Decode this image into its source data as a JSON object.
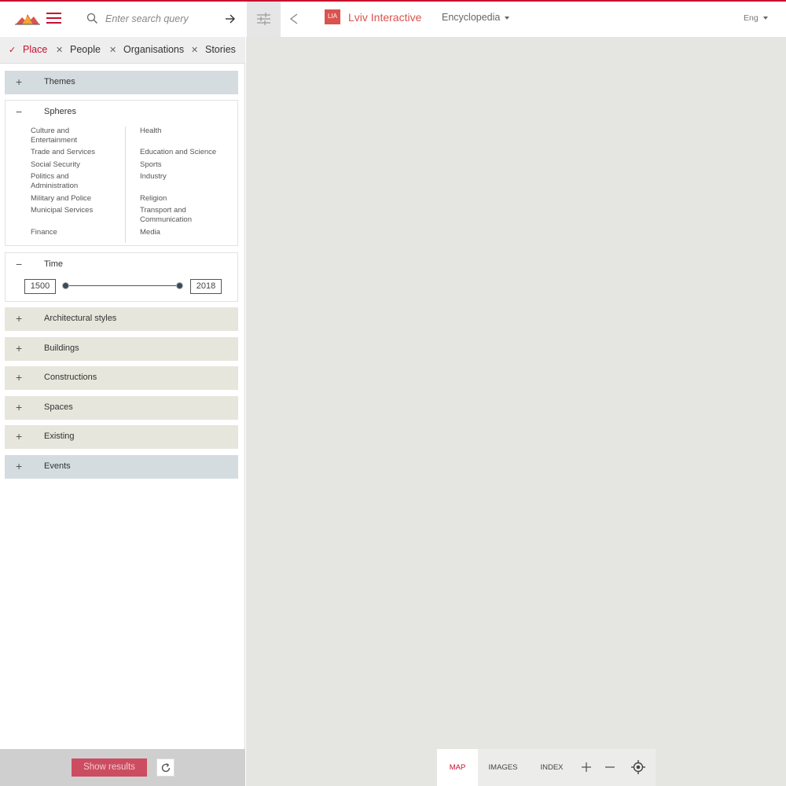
{
  "header": {
    "search_placeholder": "Enter search query",
    "lia_badge": "LIA",
    "app_title": "Lviv Interactive",
    "encyclopedia_label": "Encyclopedia",
    "language": "Eng",
    "accent_color": "#c8102e"
  },
  "tabs": [
    {
      "label": "Place",
      "active": true
    },
    {
      "label": "People",
      "active": false
    },
    {
      "label": "Organisations",
      "active": false
    },
    {
      "label": "Stories",
      "active": false
    }
  ],
  "sections": {
    "themes": "Themes",
    "spheres": "Spheres",
    "time": "Time",
    "architectural_styles": "Architectural styles",
    "buildings": "Buildings",
    "constructions": "Constructions",
    "spaces": "Spaces",
    "existing": "Existing",
    "events": "Events"
  },
  "spheres": {
    "left": [
      "Culture and Entertainment",
      "Trade and Services",
      "Social Security",
      "Politics and Administration",
      "Military and Police",
      "Municipal Services",
      "Finance"
    ],
    "right": [
      "Health",
      "Education and Science",
      "Sports",
      "Industry",
      "Religion",
      "Transport and Communication",
      "Media"
    ]
  },
  "time": {
    "start_year": "1500",
    "end_year": "2018"
  },
  "footer": {
    "show_results": "Show results"
  },
  "map_controls": {
    "map": "MAP",
    "images": "IMAGES",
    "index": "INDEX"
  }
}
